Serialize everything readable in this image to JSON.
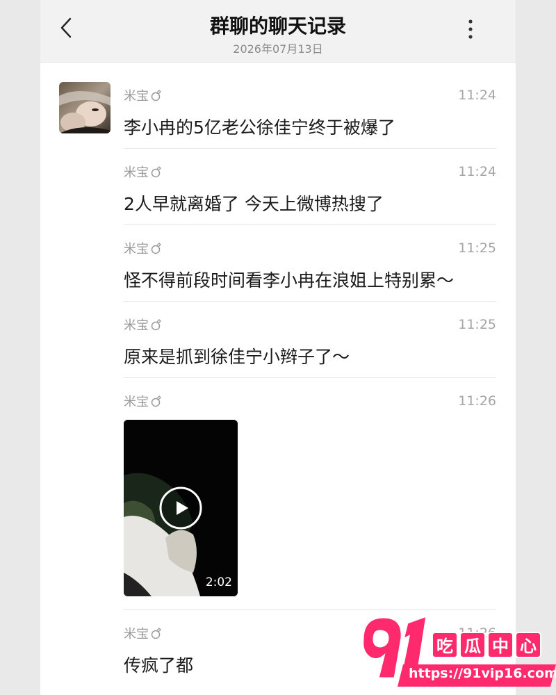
{
  "header": {
    "title": "群聊的聊天记录",
    "subtitle": "2026年07月13日",
    "back_icon": "chevron-left-icon",
    "more_icon": "more-vertical-icon"
  },
  "messages": [
    {
      "name": "米宝",
      "name_icon": "ring-icon",
      "time": "11:24",
      "text": "李小冉的5亿老公徐佳宁终于被爆了"
    },
    {
      "name": "米宝",
      "name_icon": "ring-icon",
      "time": "11:24",
      "text": "2人早就离婚了 今天上微博热搜了"
    },
    {
      "name": "米宝",
      "name_icon": "ring-icon",
      "time": "11:25",
      "text": "怪不得前段时间看李小冉在浪姐上特别累～"
    },
    {
      "name": "米宝",
      "name_icon": "ring-icon",
      "time": "11:25",
      "text": "原来是抓到徐佳宁小辫子了～"
    },
    {
      "name": "米宝",
      "name_icon": "ring-icon",
      "time": "11:26",
      "video_duration": "2:02",
      "video_icon": "play-icon"
    },
    {
      "name": "米宝",
      "name_icon": "ring-icon",
      "time": "11:26",
      "text": "传疯了都"
    }
  ],
  "watermark": {
    "logo_text": "91吃瓜中心",
    "url": "https://91vip16.com",
    "color": "#ff2a6d"
  }
}
